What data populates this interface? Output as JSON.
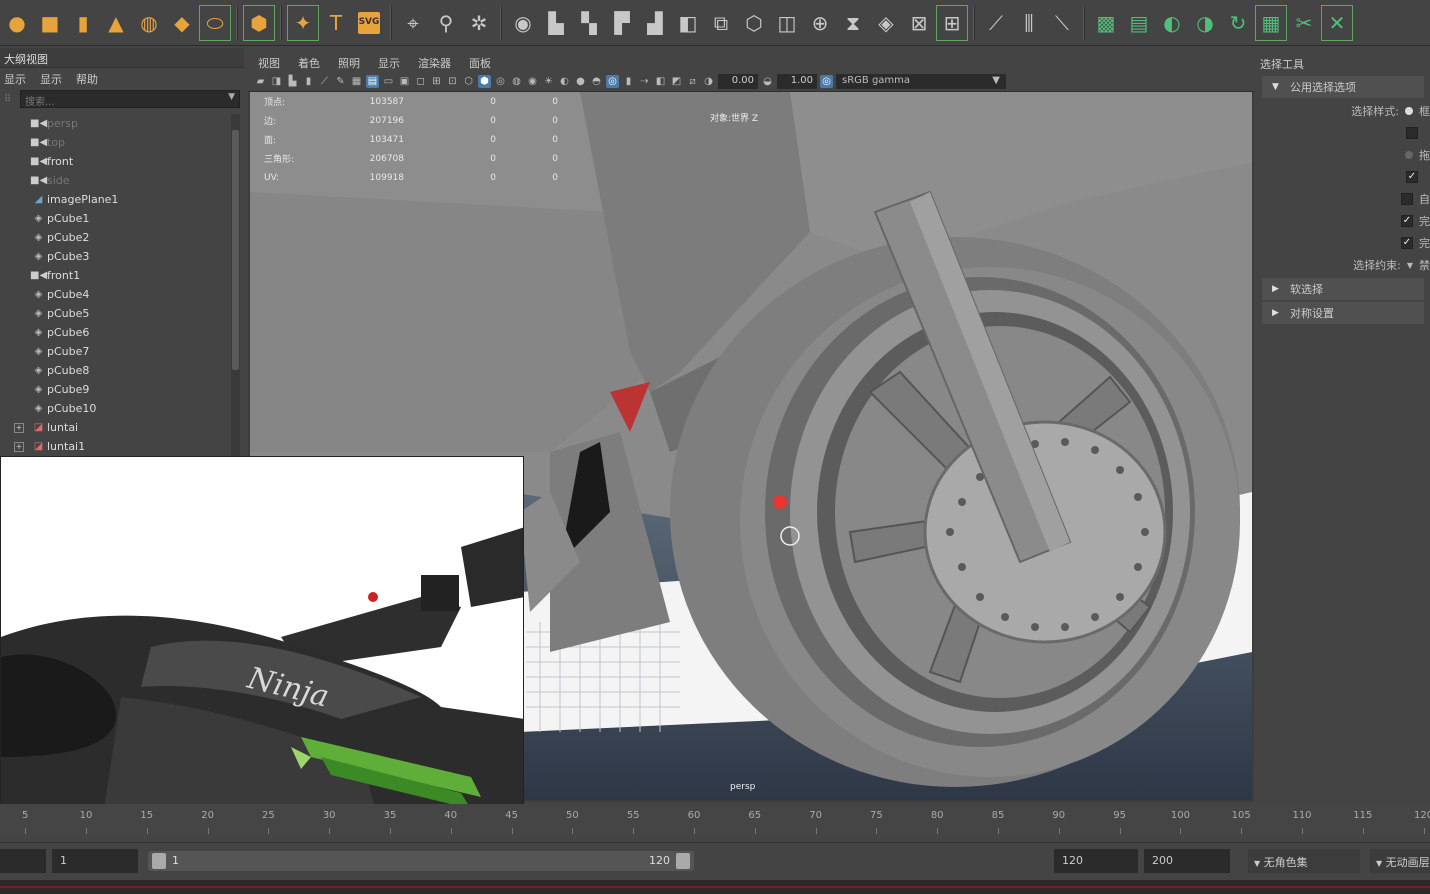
{
  "shelf": {
    "icons": [
      {
        "name": "sphere-icon",
        "glyph": "●",
        "tone": "or"
      },
      {
        "name": "cube-icon",
        "glyph": "■",
        "tone": "or"
      },
      {
        "name": "cylinder-icon",
        "glyph": "▮",
        "tone": "or"
      },
      {
        "name": "cone-icon",
        "glyph": "▲",
        "tone": "or"
      },
      {
        "name": "torus-icon",
        "glyph": "◍",
        "tone": "or"
      },
      {
        "name": "plane-icon",
        "glyph": "◆",
        "tone": "or"
      },
      {
        "name": "disc-icon",
        "glyph": "⬭",
        "tone": "or",
        "selected": true
      },
      {
        "name": "sep"
      },
      {
        "name": "platonic-icon",
        "glyph": "⬢",
        "tone": "or",
        "selected": true
      },
      {
        "name": "sep"
      },
      {
        "name": "superellipse-icon",
        "glyph": "✦",
        "tone": "or",
        "selected": true
      },
      {
        "name": "text-icon",
        "glyph": "T",
        "tone": "or"
      },
      {
        "name": "svg-icon",
        "glyph": "SVG",
        "tone": "svg"
      },
      {
        "name": "sep"
      },
      {
        "name": "pivot-icon",
        "glyph": "⌖",
        "tone": "gy"
      },
      {
        "name": "snap-icon",
        "glyph": "⚲",
        "tone": "gy"
      },
      {
        "name": "origin-icon",
        "glyph": "✲",
        "tone": "gy"
      },
      {
        "name": "sep"
      },
      {
        "name": "combine-icon",
        "glyph": "◉",
        "tone": "gy"
      },
      {
        "name": "separate-icon",
        "glyph": "▙",
        "tone": "gy"
      },
      {
        "name": "extract-icon",
        "glyph": "▚",
        "tone": "gy"
      },
      {
        "name": "booleans-icon",
        "glyph": "▛",
        "tone": "gy"
      },
      {
        "name": "smooth-icon",
        "glyph": "▟",
        "tone": "gy"
      },
      {
        "name": "extrude-icon",
        "glyph": "◧",
        "tone": "gy"
      },
      {
        "name": "bridge-icon",
        "glyph": "⧉",
        "tone": "gy"
      },
      {
        "name": "bevel-icon",
        "glyph": "⬡",
        "tone": "gy"
      },
      {
        "name": "multicut-icon",
        "glyph": "◫",
        "tone": "gy"
      },
      {
        "name": "fill-hole-icon",
        "glyph": "⊕",
        "tone": "gy"
      },
      {
        "name": "merge-icon",
        "glyph": "⧗",
        "tone": "gy"
      },
      {
        "name": "append-icon",
        "glyph": "◈",
        "tone": "gy"
      },
      {
        "name": "mirror-icon",
        "glyph": "⊠",
        "tone": "gy"
      },
      {
        "name": "triangulate-icon",
        "glyph": "⊞",
        "tone": "gy",
        "selected": true
      },
      {
        "name": "sep"
      },
      {
        "name": "knife-icon",
        "glyph": "⟋",
        "tone": "gy"
      },
      {
        "name": "edge-loop-icon",
        "glyph": "⫼",
        "tone": "gy"
      },
      {
        "name": "slide-edge-icon",
        "glyph": "⟍",
        "tone": "gy"
      },
      {
        "name": "sep"
      },
      {
        "name": "uv-editor-icon",
        "glyph": "▩",
        "tone": "gr"
      },
      {
        "name": "uv-planar-icon",
        "glyph": "▤",
        "tone": "gr"
      },
      {
        "name": "uv-cylindrical-icon",
        "glyph": "◐",
        "tone": "gr"
      },
      {
        "name": "uv-spherical-icon",
        "glyph": "◑",
        "tone": "gr"
      },
      {
        "name": "uv-auto-icon",
        "glyph": "↻",
        "tone": "gr"
      },
      {
        "name": "checker-icon",
        "glyph": "▦",
        "tone": "gr",
        "selected": true
      },
      {
        "name": "uv-cut-icon",
        "glyph": "✂",
        "tone": "gr"
      },
      {
        "name": "uv-sew-icon",
        "glyph": "✕",
        "tone": "gr",
        "selected": true
      }
    ]
  },
  "outliner": {
    "title": "大纲视图",
    "menu": [
      "显示",
      "显示",
      "帮助"
    ],
    "search_placeholder": "搜索...",
    "items": [
      {
        "label": "persp",
        "icon": "camera-icon",
        "dim": true
      },
      {
        "label": "top",
        "icon": "camera-icon",
        "dim": true
      },
      {
        "label": "front",
        "icon": "camera-icon",
        "dim": false
      },
      {
        "label": "side",
        "icon": "camera-icon",
        "dim": true
      },
      {
        "label": "imagePlane1",
        "icon": "image-plane-icon",
        "dim": false
      },
      {
        "label": "pCube1",
        "icon": "mesh-icon",
        "dim": false
      },
      {
        "label": "pCube2",
        "icon": "mesh-icon",
        "dim": false
      },
      {
        "label": "pCube3",
        "icon": "mesh-icon",
        "dim": false
      },
      {
        "label": "front1",
        "icon": "camera-icon",
        "dim": false
      },
      {
        "label": "pCube4",
        "icon": "mesh-icon",
        "dim": false
      },
      {
        "label": "pCube5",
        "icon": "mesh-icon",
        "dim": false
      },
      {
        "label": "pCube6",
        "icon": "mesh-icon",
        "dim": false
      },
      {
        "label": "pCube7",
        "icon": "mesh-icon",
        "dim": false
      },
      {
        "label": "pCube8",
        "icon": "mesh-icon",
        "dim": false
      },
      {
        "label": "pCube9",
        "icon": "mesh-icon",
        "dim": false
      },
      {
        "label": "pCube10",
        "icon": "mesh-icon",
        "dim": false
      },
      {
        "label": "luntai",
        "icon": "group-icon",
        "dim": false,
        "expandable": true
      },
      {
        "label": "luntai1",
        "icon": "group-icon",
        "dim": false,
        "expandable": true
      }
    ]
  },
  "viewport_panel": {
    "menu": [
      "视图",
      "着色",
      "照明",
      "显示",
      "渲染器",
      "面板"
    ],
    "exposure": "0.00",
    "gamma": "1.00",
    "color_space": "sRGB gamma",
    "camera_label": "persp",
    "hud": {
      "rows": [
        {
          "key": "顶点:",
          "value": "103587",
          "c1": "0",
          "c2": "0"
        },
        {
          "key": "边:",
          "value": "207196",
          "c1": "0",
          "c2": "0"
        },
        {
          "key": "面:",
          "value": "103471",
          "c1": "0",
          "c2": "0"
        },
        {
          "key": "三角形:",
          "value": "206708",
          "c1": "0",
          "c2": "0"
        },
        {
          "key": "UV:",
          "value": "109918",
          "c1": "0",
          "c2": "0"
        }
      ],
      "object_label": "对象:世界 Z"
    }
  },
  "reference_photo": {
    "logo_text": "Ninja"
  },
  "attribute_panel": {
    "title": "选择工具",
    "section_common": "公用选择选项",
    "selection_style_label": "选择样式:",
    "selection_style_value": "框",
    "option_drag": "拖",
    "option_auto": "自",
    "option_complete1": "完",
    "option_complete2": "完",
    "constraint_label": "选择约束:",
    "constraint_value": "禁",
    "section_soft": "软选择",
    "section_symmetry": "对称设置"
  },
  "timeline": {
    "ticks": [
      5,
      10,
      15,
      20,
      25,
      30,
      35,
      40,
      45,
      50,
      55,
      60,
      65,
      70,
      75,
      80,
      85,
      90,
      95,
      100,
      105,
      110,
      115,
      120
    ]
  },
  "range_bar": {
    "start_field": "1",
    "range_start": "1",
    "range_end": "120",
    "end_field": "120",
    "anim_end": "200",
    "character_set": "无角色集",
    "anim_layer": "无动画层"
  }
}
